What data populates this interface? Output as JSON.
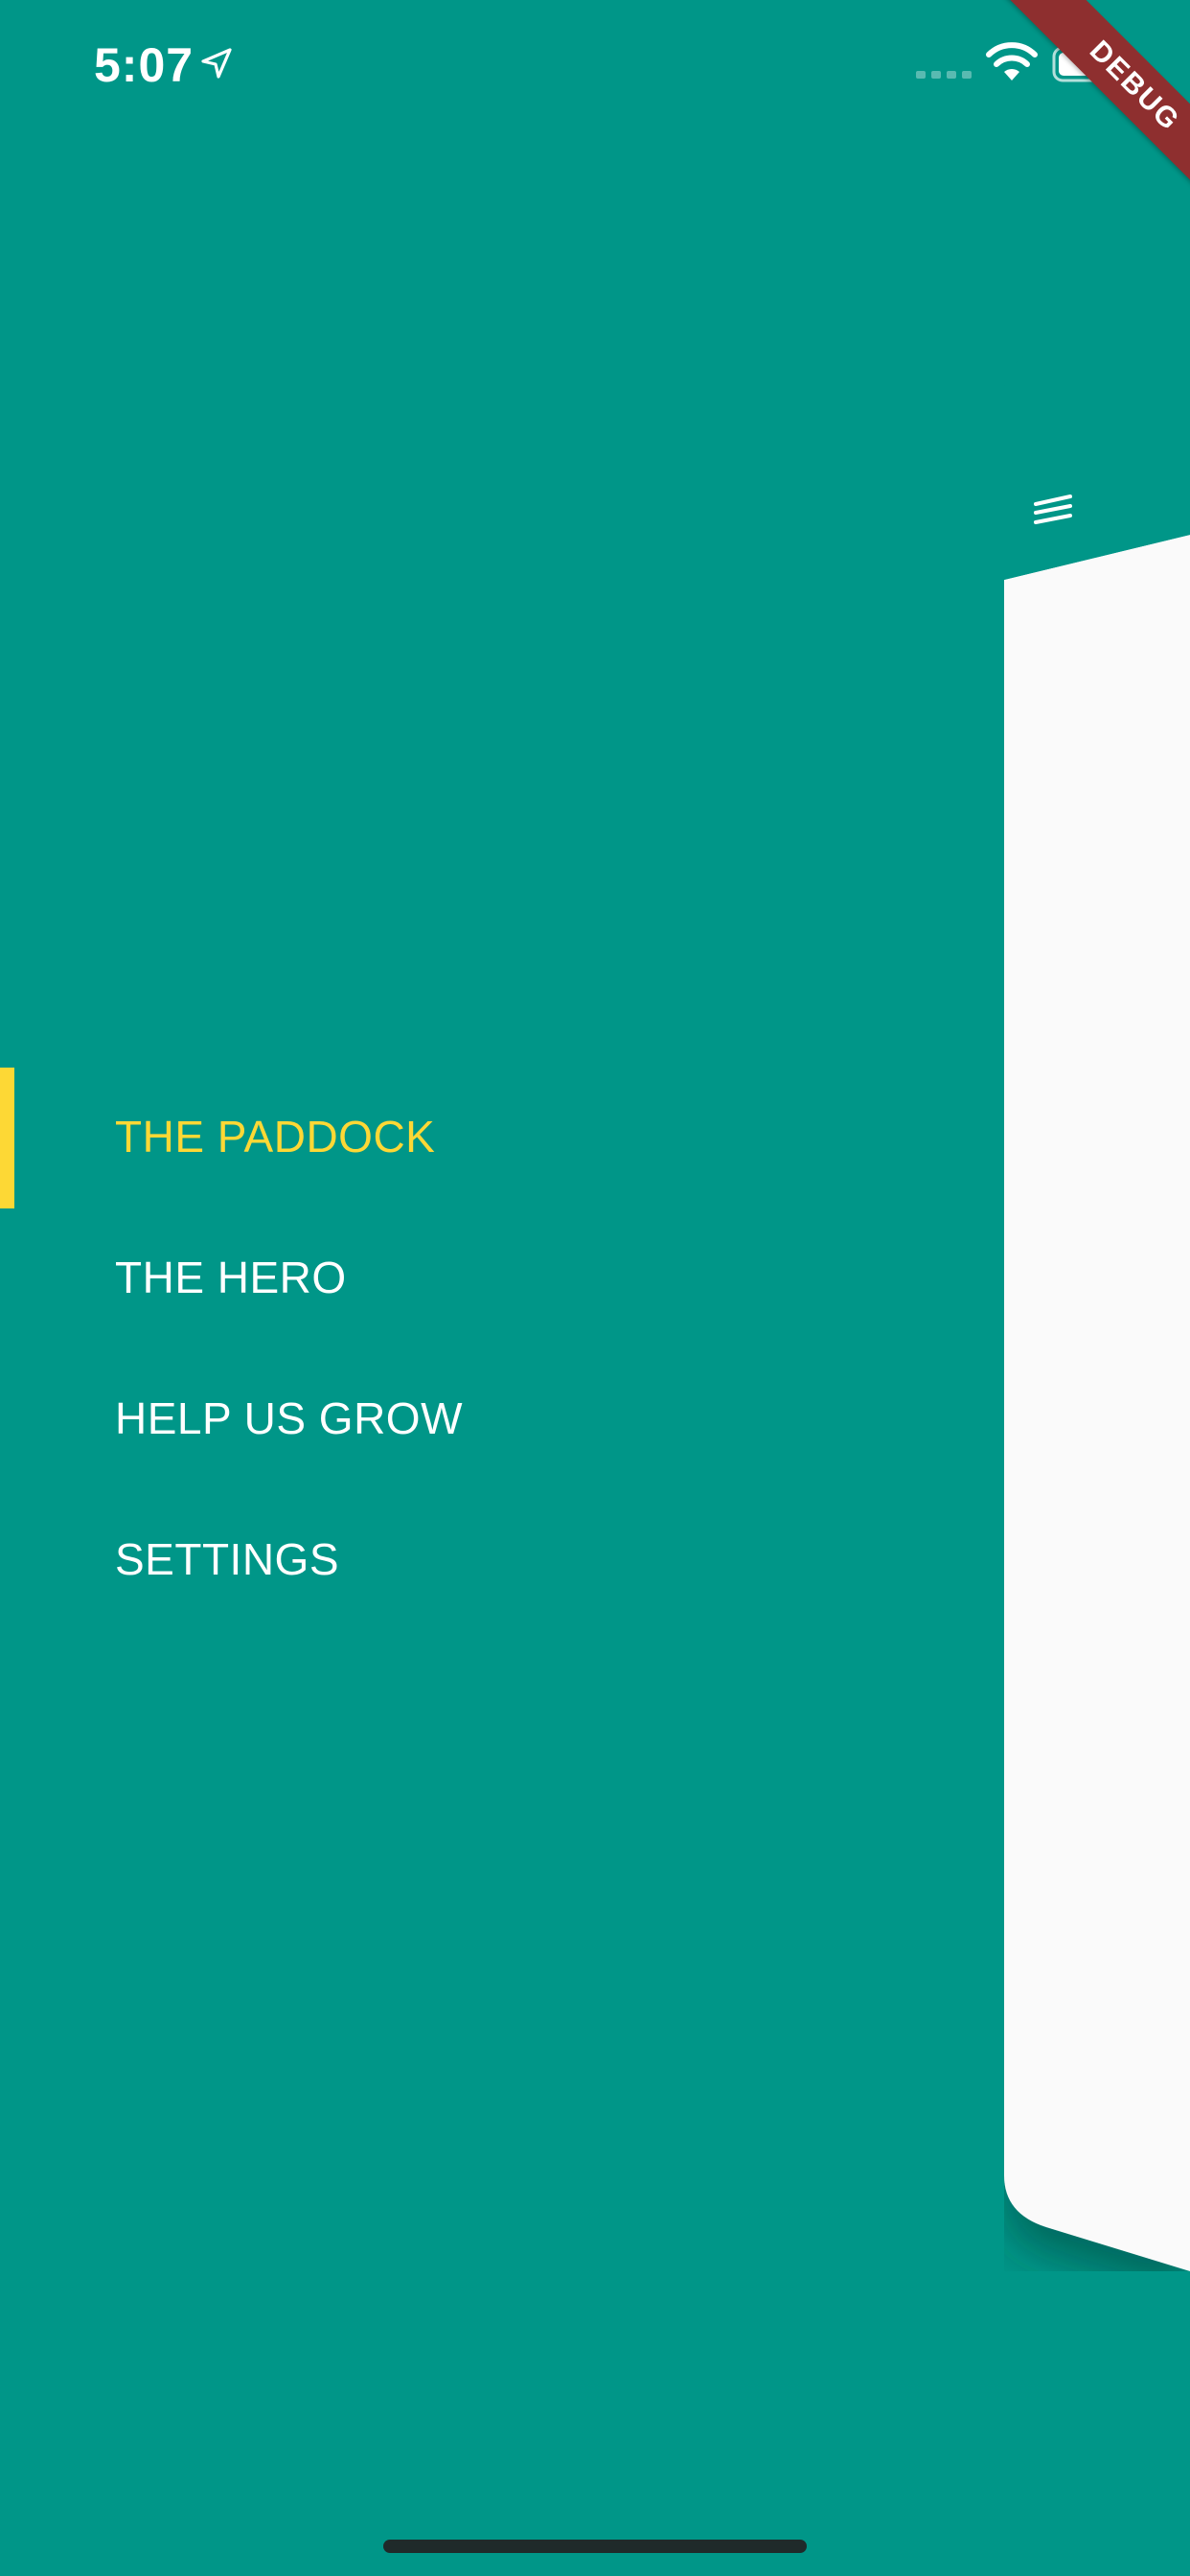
{
  "status_bar": {
    "time": "5:07"
  },
  "debug_banner": {
    "label": "DEBUG"
  },
  "drawer": {
    "items": [
      {
        "label": "THE PADDOCK",
        "active": true
      },
      {
        "label": "THE HERO",
        "active": false
      },
      {
        "label": "HELP US GROW",
        "active": false
      },
      {
        "label": "SETTINGS",
        "active": false
      }
    ]
  },
  "icons": {
    "location": "location-arrow-icon",
    "signal": "cellular-signal-icon",
    "wifi": "wifi-icon",
    "battery": "battery-icon",
    "menu": "hamburger-menu-icon"
  },
  "colors": {
    "background": "#009688",
    "active_item": "#fdd835",
    "inactive_item": "#ffffff",
    "main_screen_body": "#fafafa",
    "debug_banner": "#8e2f2f"
  }
}
